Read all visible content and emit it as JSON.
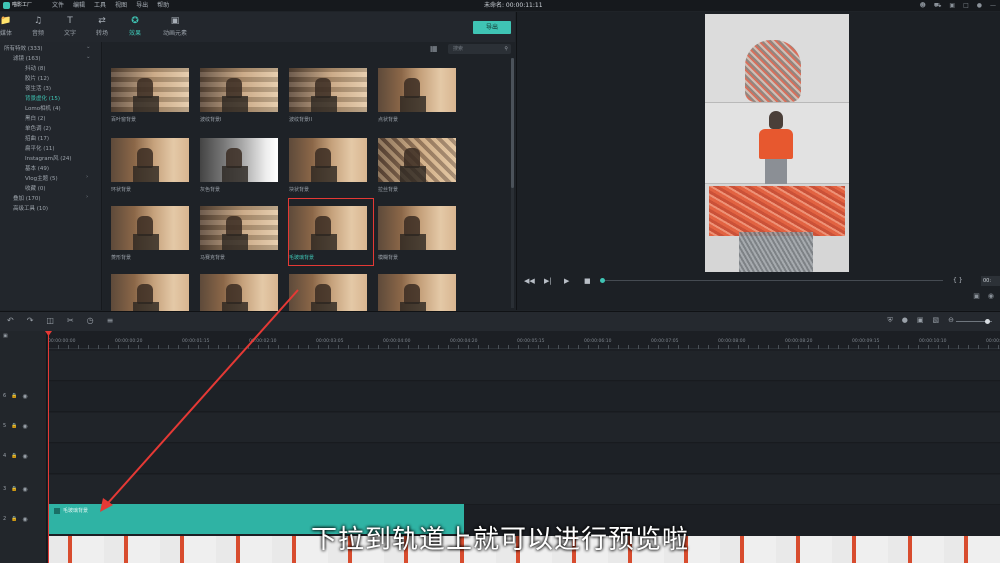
{
  "app": {
    "logo_text": "喵影工厂",
    "project_title": "未命名: 00:00:11:11"
  },
  "menu": [
    "文件",
    "编辑",
    "工具",
    "视图",
    "导出",
    "帮助"
  ],
  "top_icons": [
    "user-icon",
    "cart-icon",
    "gift-icon",
    "notification-icon",
    "microphone-icon",
    "minimize-icon"
  ],
  "media_tabs": [
    {
      "label": "媒体",
      "icon": "folder-icon"
    },
    {
      "label": "音频",
      "icon": "music-icon"
    },
    {
      "label": "文字",
      "icon": "text-icon"
    },
    {
      "label": "转场",
      "icon": "transition-icon"
    },
    {
      "label": "效果",
      "icon": "effects-icon",
      "active": true
    },
    {
      "label": "动画元素",
      "icon": "elements-icon"
    }
  ],
  "export_label": "导出",
  "categories": [
    {
      "label": "所有特效 (333)",
      "expanded": true
    },
    {
      "label": "滤镜 (163)",
      "expanded": true
    },
    {
      "label": "抖动 (8)"
    },
    {
      "label": "胶片 (12)"
    },
    {
      "label": "夜生活 (3)"
    },
    {
      "label": "背景虚化 (15)",
      "active": true
    },
    {
      "label": "Lomo相机 (4)"
    },
    {
      "label": "黑白 (2)"
    },
    {
      "label": "单色调 (2)"
    },
    {
      "label": "招曲 (17)"
    },
    {
      "label": "扁平化 (11)"
    },
    {
      "label": "Instagram风 (24)"
    },
    {
      "label": "基本 (49)"
    },
    {
      "label": "Vlog主题 (5)"
    },
    {
      "label": "收藏 (0)"
    },
    {
      "label": "叠加 (170)"
    },
    {
      "label": "高级工具 (10)"
    }
  ],
  "search_placeholder": "搜索",
  "effects": [
    {
      "label": "百叶窗背景",
      "style": "tiles"
    },
    {
      "label": "波纹背景I",
      "style": "tiles"
    },
    {
      "label": "波纹背景II",
      "style": "tiles"
    },
    {
      "label": "点状背景",
      "style": "normal"
    },
    {
      "label": "环状背景",
      "style": "normal"
    },
    {
      "label": "灰色背景",
      "style": "gray"
    },
    {
      "label": "块状背景",
      "style": "normal"
    },
    {
      "label": "拉丝背景",
      "style": "check"
    },
    {
      "label": "菱形背景",
      "style": "normal"
    },
    {
      "label": "马赛克背景",
      "style": "tiles"
    },
    {
      "label": "毛玻璃背景",
      "style": "normal",
      "selected": true
    },
    {
      "label": "模糊背景",
      "style": "normal"
    },
    {
      "label": "",
      "style": "normal"
    },
    {
      "label": "",
      "style": "normal"
    },
    {
      "label": "",
      "style": "normal"
    },
    {
      "label": "",
      "style": "normal"
    }
  ],
  "preview": {
    "time": "00:"
  },
  "timeline_toolbar": {
    "left_icons": [
      "undo-icon",
      "redo-icon",
      "delete-icon",
      "cut-icon",
      "clock-icon",
      "adjust-icon"
    ],
    "right_icons": [
      "shield-icon",
      "microphone-icon",
      "voiceover-icon",
      "subtitle-icon",
      "zoom-out-icon"
    ]
  },
  "ruler_ticks": [
    "00:00:00:00",
    "00:00:00:20",
    "00:00:01:15",
    "00:00:02:10",
    "00:00:03:05",
    "00:00:04:00",
    "00:00:04:20",
    "00:00:05:15",
    "00:00:06:10",
    "00:00:07:05",
    "00:00:08:00",
    "00:00:08:20",
    "00:00:09:15",
    "00:00:10:10",
    "00:00:11:05"
  ],
  "track_labels": [
    "6",
    "5",
    "4",
    "3",
    "2"
  ],
  "clips": {
    "effect_label": "毛玻璃背景"
  },
  "subtitle": "下拉到轨道上就可以进行预览啦"
}
